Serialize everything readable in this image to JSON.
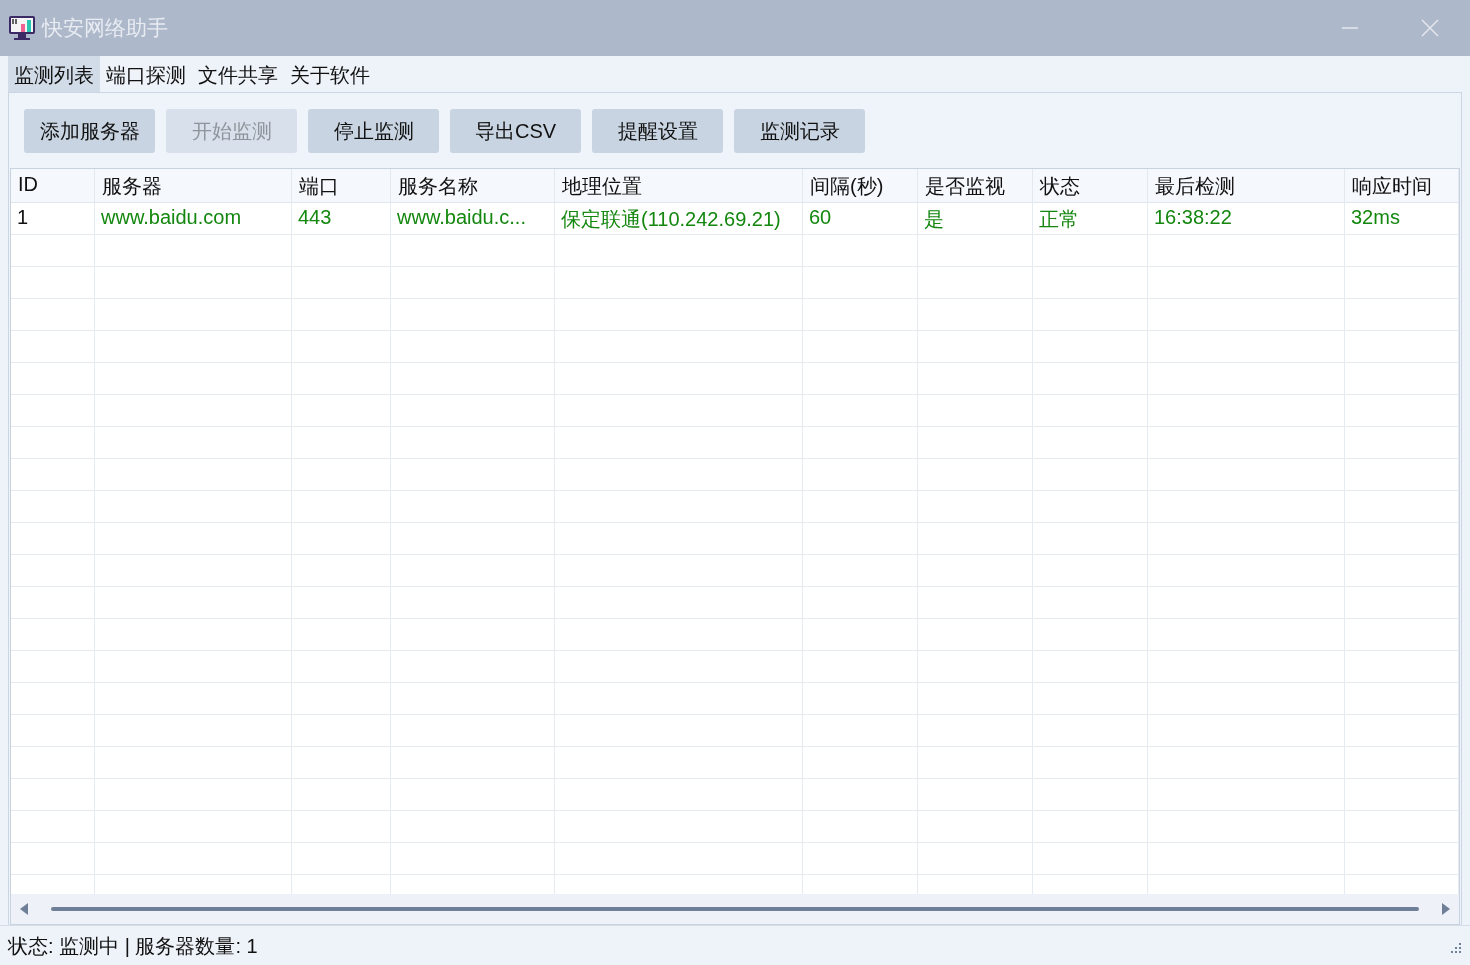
{
  "window": {
    "title": "快安网络助手"
  },
  "tabs": [
    {
      "label": "监测列表",
      "selected": true
    },
    {
      "label": "端口探测",
      "selected": false
    },
    {
      "label": "文件共享",
      "selected": false
    },
    {
      "label": "关于软件",
      "selected": false
    }
  ],
  "toolbar": [
    {
      "label": "添加服务器",
      "disabled": false
    },
    {
      "label": "开始监测",
      "disabled": true
    },
    {
      "label": "停止监测",
      "disabled": false
    },
    {
      "label": "导出CSV",
      "disabled": false
    },
    {
      "label": "提醒设置",
      "disabled": false
    },
    {
      "label": "监测记录",
      "disabled": false
    }
  ],
  "table": {
    "columns": [
      "ID",
      "服务器",
      "端口",
      "服务名称",
      "地理位置",
      "间隔(秒)",
      "是否监视",
      "状态",
      "最后检测",
      "响应时间"
    ],
    "rows": [
      {
        "cells": [
          "1",
          "www.baidu.com",
          "443",
          "www.baidu.c...",
          "保定联通(110.242.69.21)",
          "60",
          "是",
          "正常",
          "16:38:22",
          "32ms"
        ],
        "healthy": true
      }
    ]
  },
  "status_bar": "状态: 监测中 | 服务器数量: 1"
}
